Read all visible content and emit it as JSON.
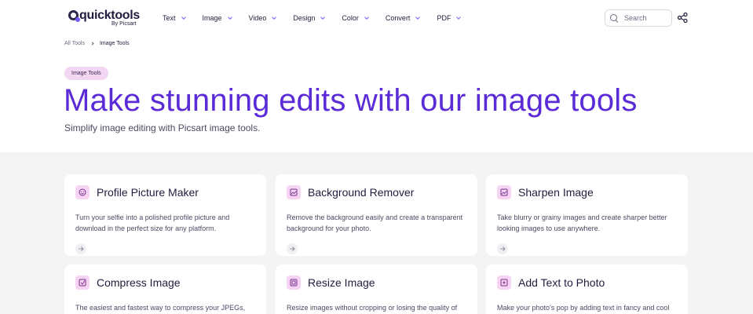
{
  "header": {
    "logo": {
      "wordmark": "quicktools",
      "byline": "By Picsart"
    },
    "nav": [
      {
        "label": "Text"
      },
      {
        "label": "Image"
      },
      {
        "label": "Video"
      },
      {
        "label": "Design"
      },
      {
        "label": "Color"
      },
      {
        "label": "Convert"
      },
      {
        "label": "PDF"
      }
    ],
    "search": {
      "placeholder": "Search",
      "value": ""
    }
  },
  "breadcrumb": {
    "root": "All Tools",
    "current": "Image Tools"
  },
  "hero": {
    "badge": "Image Tools",
    "title": "Make stunning edits with our image tools",
    "subtitle": "Simplify image editing with Picsart image tools."
  },
  "colors": {
    "accent": "#5a2bd6",
    "icon_bg": "#f6d5f4",
    "badge_bg": "#f3d6f1",
    "section_bg": "#f4f4f5"
  },
  "tools": [
    {
      "title": "Profile Picture Maker",
      "description": "Turn your selfie into a polished profile picture and download in the perfect size for any platform.",
      "icon": "profile-face-icon"
    },
    {
      "title": "Background Remover",
      "description": "Remove the background easily and create a transparent background for your photo.",
      "icon": "image-icon"
    },
    {
      "title": "Sharpen Image",
      "description": "Take blurry or grainy images and create sharper better looking images to use anywhere.",
      "icon": "image-icon"
    },
    {
      "title": "Compress Image",
      "description": "The easiest and fastest way to compress your JPEGs, PNGs, and any other images.",
      "icon": "compress-image-icon"
    },
    {
      "title": "Resize Image",
      "description": "Resize images without cropping or losing the quality of the original image.",
      "icon": "resize-image-icon"
    },
    {
      "title": "Add Text to Photo",
      "description": "Make your photo's pop by adding text in fancy and cool fonts before publishing anywhere.",
      "icon": "add-text-icon"
    }
  ]
}
